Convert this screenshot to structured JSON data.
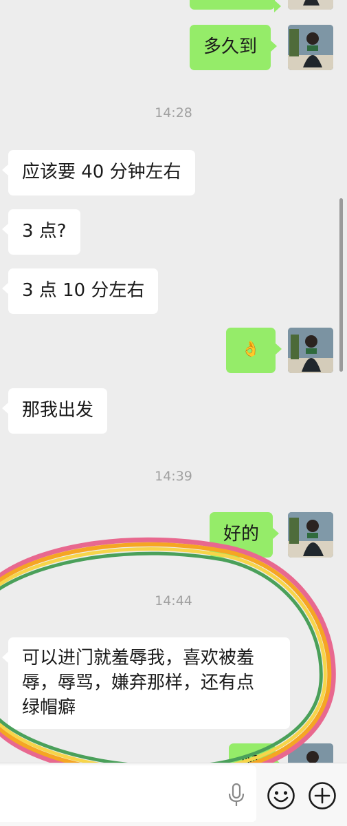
{
  "colors": {
    "background": "#ededed",
    "incoming_bubble": "#ffffff",
    "outgoing_bubble": "#95ec69",
    "timestamp": "#a0a0a0"
  },
  "messages": {
    "m1": "多久到",
    "t1": "14:28",
    "m2": "应该要 40 分钟左右",
    "m3": "3 点?",
    "m4": "3 点 10 分左右",
    "m5_emoji": "👌",
    "m6": "那我出发",
    "t2": "14:39",
    "m7": "好的",
    "t3": "14:44",
    "m8": "可以进门就羞辱我，喜欢被羞\n辱，辱骂，嫌弃那样，还有点\n绿帽癖",
    "m9_partial": "嗯"
  },
  "icons": {
    "voice": "mic-icon",
    "emoji": "smiley-face-icon",
    "more": "plus-circle-icon"
  },
  "annotation": {
    "type": "hand-drawn rainbow ellipse around last messages",
    "stroke_colors": [
      "#e8688f",
      "#f5a623",
      "#f7d54a",
      "#4aa05a"
    ]
  }
}
